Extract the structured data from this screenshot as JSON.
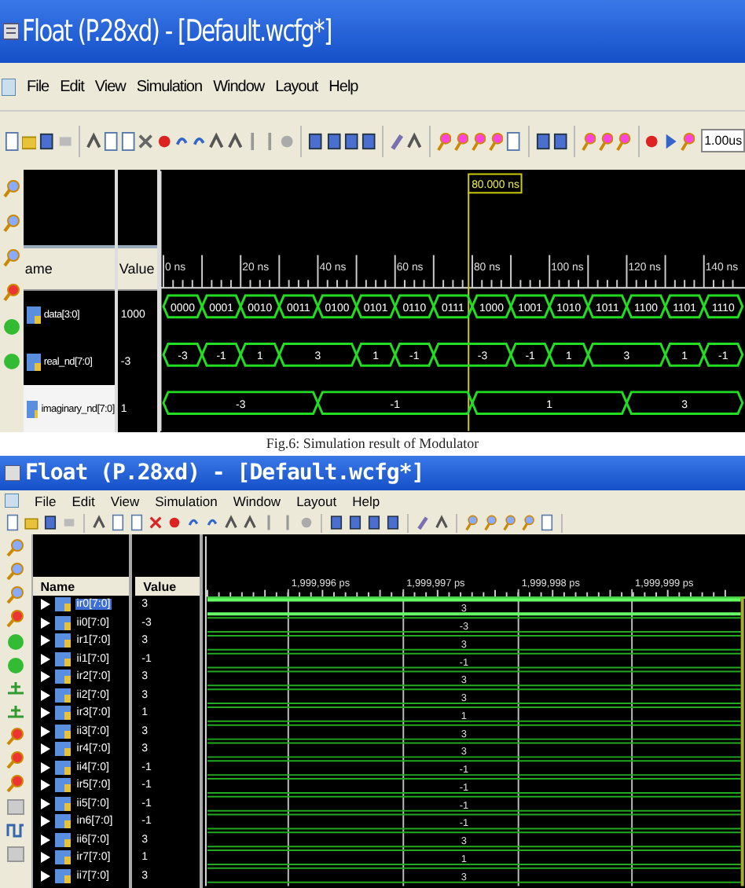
{
  "window_1": {
    "title": "Float (P.28xd) - [Default.wcfg*]",
    "menu": [
      "File",
      "Edit",
      "View",
      "Simulation",
      "Window",
      "Layout",
      "Help"
    ],
    "time_field": "1.00us",
    "cursor_label": "80.000 ns",
    "columns": [
      "ame",
      "Value"
    ],
    "time_labels": [
      "0 ns",
      "20 ns",
      "40 ns",
      "60 ns",
      "80 ns",
      "100 ns",
      "120 ns",
      "140 ns"
    ],
    "signals": [
      {
        "name": "data[3:0]",
        "value": "1000",
        "selected": false,
        "slots": [
          {
            "kind": "new",
            "value": "0000"
          },
          {
            "kind": "new",
            "value": "0001"
          },
          {
            "kind": "new",
            "value": "0010"
          },
          {
            "kind": "new",
            "value": "0011"
          },
          {
            "kind": "new",
            "value": "0100"
          },
          {
            "kind": "new",
            "value": "0101"
          },
          {
            "kind": "new",
            "value": "0110"
          },
          {
            "kind": "new",
            "value": "0111"
          },
          {
            "kind": "new",
            "value": "1000"
          },
          {
            "kind": "new",
            "value": "1001"
          },
          {
            "kind": "new",
            "value": "1010"
          },
          {
            "kind": "new",
            "value": "1011"
          },
          {
            "kind": "new",
            "value": "1100"
          },
          {
            "kind": "new",
            "value": "1101"
          },
          {
            "kind": "new",
            "value": "1110"
          }
        ]
      },
      {
        "name": "real_nd[7:0]",
        "value": "-3",
        "selected": false,
        "slots": [
          {
            "kind": "new",
            "value": "-3"
          },
          {
            "kind": "new",
            "value": "-1"
          },
          {
            "kind": "new",
            "value": "1"
          },
          {
            "kind": "new",
            "value": "3"
          },
          {
            "kind": "hold"
          },
          {
            "kind": "new",
            "value": "1"
          },
          {
            "kind": "new",
            "value": "-1"
          },
          {
            "kind": "new",
            "value": "-3"
          },
          {
            "kind": "hold"
          },
          {
            "kind": "new",
            "value": "-1"
          },
          {
            "kind": "new",
            "value": "1"
          },
          {
            "kind": "new",
            "value": "3"
          },
          {
            "kind": "hold"
          },
          {
            "kind": "new",
            "value": "1"
          },
          {
            "kind": "new",
            "value": "-1"
          }
        ]
      },
      {
        "name": "imaginary_nd[7:0]",
        "value": "1",
        "selected": true,
        "slots": [
          {
            "kind": "new",
            "value": "-3"
          },
          {
            "kind": "hold"
          },
          {
            "kind": "hold"
          },
          {
            "kind": "hold"
          },
          {
            "kind": "new",
            "value": "-1"
          },
          {
            "kind": "hold"
          },
          {
            "kind": "hold"
          },
          {
            "kind": "hold"
          },
          {
            "kind": "new",
            "value": "1"
          },
          {
            "kind": "hold"
          },
          {
            "kind": "hold"
          },
          {
            "kind": "hold"
          },
          {
            "kind": "new",
            "value": "3"
          },
          {
            "kind": "hold"
          },
          {
            "kind": "hold"
          }
        ]
      }
    ]
  },
  "caption": "Fig.6: Simulation result of Modulator",
  "window_2": {
    "title": "Float (P.28xd) - [Default.wcfg*]",
    "menu": [
      "File",
      "Edit",
      "View",
      "Simulation",
      "Window",
      "Layout",
      "Help"
    ],
    "columns": [
      "Name",
      "Value"
    ],
    "time_labels": [
      "1,999,996 ps",
      "1,999,997 ps",
      "1,999,998 ps",
      "1,999,999 ps"
    ],
    "signals": [
      {
        "name": "ir0[7:0]",
        "value": "3",
        "wave_value": "3",
        "selected": true
      },
      {
        "name": "ii0[7:0]",
        "value": "-3",
        "wave_value": "-3",
        "selected": false
      },
      {
        "name": "ir1[7:0]",
        "value": "3",
        "wave_value": "3",
        "selected": false
      },
      {
        "name": "ii1[7:0]",
        "value": "-1",
        "wave_value": "-1",
        "selected": false
      },
      {
        "name": "ir2[7:0]",
        "value": "3",
        "wave_value": "3",
        "selected": false
      },
      {
        "name": "ii2[7:0]",
        "value": "3",
        "wave_value": "3",
        "selected": false
      },
      {
        "name": "ir3[7:0]",
        "value": "1",
        "wave_value": "1",
        "selected": false
      },
      {
        "name": "ii3[7:0]",
        "value": "3",
        "wave_value": "3",
        "selected": false
      },
      {
        "name": "ir4[7:0]",
        "value": "3",
        "wave_value": "3",
        "selected": false
      },
      {
        "name": "ii4[7:0]",
        "value": "-1",
        "wave_value": "-1",
        "selected": false
      },
      {
        "name": "ir5[7:0]",
        "value": "-1",
        "wave_value": "-1",
        "selected": false
      },
      {
        "name": "ii5[7:0]",
        "value": "-1",
        "wave_value": "-1",
        "selected": false
      },
      {
        "name": "in6[7:0]",
        "value": "-1",
        "wave_value": "-1",
        "selected": false
      },
      {
        "name": "ii6[7:0]",
        "value": "3",
        "wave_value": "3",
        "selected": false
      },
      {
        "name": "ir7[7:0]",
        "value": "1",
        "wave_value": "1",
        "selected": false
      },
      {
        "name": "ii7[7:0]",
        "value": "3",
        "wave_value": "3",
        "selected": false
      }
    ]
  }
}
